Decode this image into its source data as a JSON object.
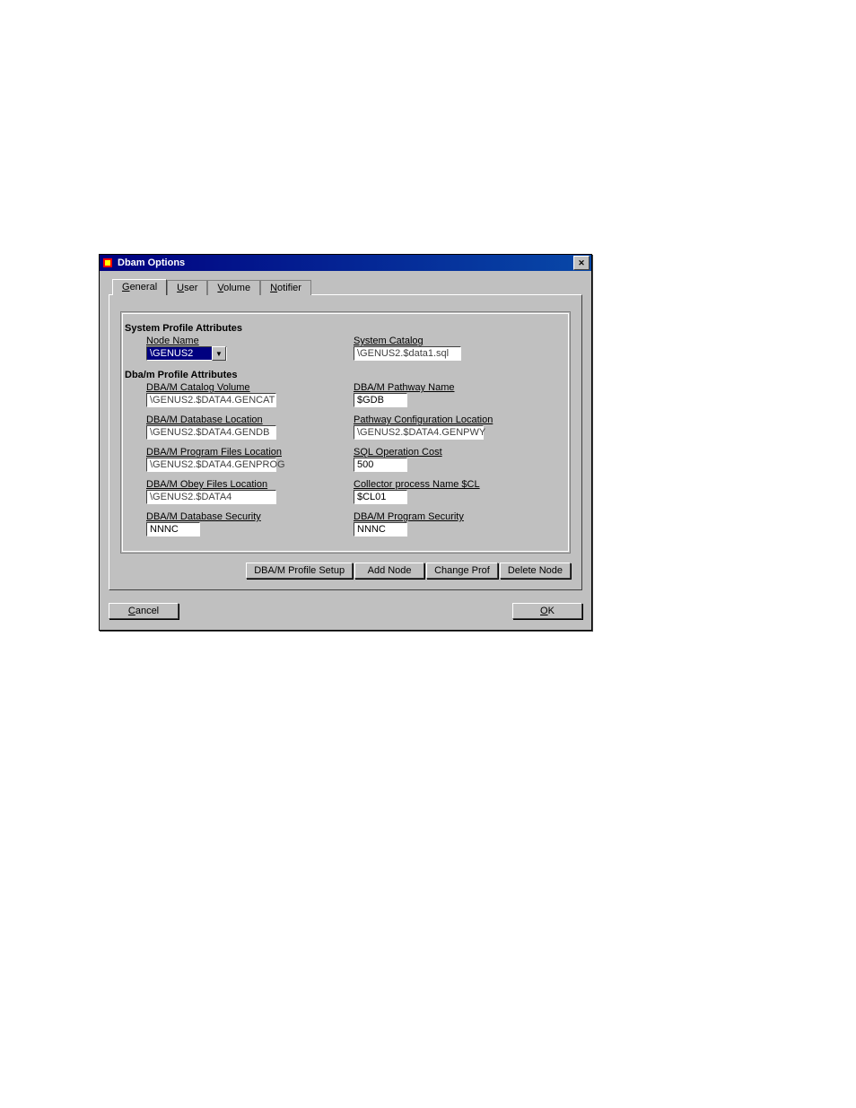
{
  "window": {
    "title": "Dbam Options"
  },
  "tabs": {
    "general": "General",
    "user": "User",
    "volume": "Volume",
    "notifier": "Notifier"
  },
  "group": {
    "sysTitle": "System Profile Attributes",
    "dbamTitle": "Dba/m Profile Attributes",
    "nodeNameLabel": "Node Name",
    "nodeNameValue": "\\GENUS2",
    "systemCatalogLabel": "System Catalog",
    "systemCatalogValue": "\\GENUS2.$data1.sql",
    "catalogVolumeLabel": "DBA/M Catalog Volume",
    "catalogVolumeValue": "\\GENUS2.$DATA4.GENCAT",
    "pathwayNameLabel": "DBA/M Pathway Name",
    "pathwayNameValue": "$GDB",
    "dbLocationLabel": "DBA/M Database Location",
    "dbLocationValue": "\\GENUS2.$DATA4.GENDB",
    "pathwayConfigLabel": "Pathway Configuration Location",
    "pathwayConfigValue": "\\GENUS2.$DATA4.GENPWY",
    "progFilesLabel": "DBA/M Program Files Location",
    "progFilesValue": "\\GENUS2.$DATA4.GENPROG",
    "sqlCostLabel": "SQL Operation Cost",
    "sqlCostValue": "500",
    "obeyFilesLabel": "DBA/M Obey Files Location",
    "obeyFilesValue": "\\GENUS2.$DATA4",
    "collectorLabel": "Collector process Name $CL",
    "collectorValue": "$CL01",
    "dbSecurityLabel": "DBA/M Database Security",
    "dbSecurityValue": "NNNC",
    "progSecurityLabel": "DBA/M Program Security",
    "progSecurityValue": "NNNC"
  },
  "buttons": {
    "profileSetup": "DBA/M Profile Setup",
    "addNode": "Add Node",
    "changeProf": "Change Prof",
    "deleteNode": "Delete Node",
    "cancel": "Cancel",
    "ok": "OK"
  }
}
